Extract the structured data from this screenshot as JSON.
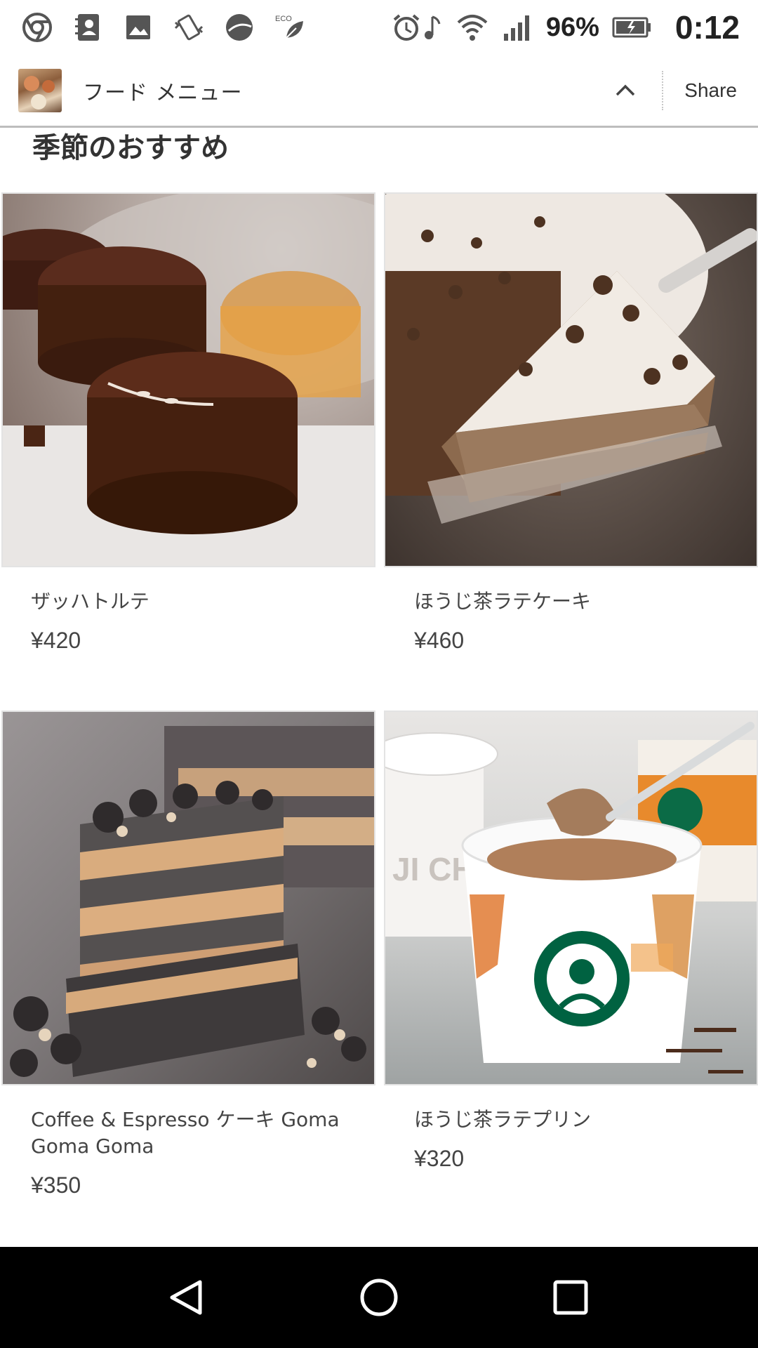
{
  "status_bar": {
    "left_icons": [
      "chrome-icon",
      "contacts-icon",
      "gallery-icon",
      "vibrate-icon",
      "dark-circle-icon",
      "eco-leaf-icon"
    ],
    "eco_label": "ECO",
    "right_icons": [
      "alarm-icon",
      "music-note-icon",
      "wifi-icon",
      "signal-icon",
      "battery-icon"
    ],
    "battery_percent": "96%",
    "time": "0:12"
  },
  "tab_header": {
    "title": "フード メニュー",
    "share_label": "Share"
  },
  "content": {
    "section_heading": "季節のおすすめ",
    "products": [
      {
        "name": "ザッハトルテ",
        "price": "¥420"
      },
      {
        "name": "ほうじ茶ラテケーキ",
        "price": "¥460"
      },
      {
        "name": "Coffee & Espresso ケーキ Goma Goma Goma",
        "price": "¥350"
      },
      {
        "name": "ほうじ茶ラテプリン",
        "price": "¥320"
      }
    ],
    "cup_text": "JI CHA"
  },
  "nav_bar": {
    "buttons": [
      "back-icon",
      "home-icon",
      "recents-icon"
    ]
  },
  "colors": {
    "nav_bg": "#000000",
    "header_divider": "#bdbdbd",
    "text_primary": "#333333",
    "starbucks_green": "#006241"
  }
}
